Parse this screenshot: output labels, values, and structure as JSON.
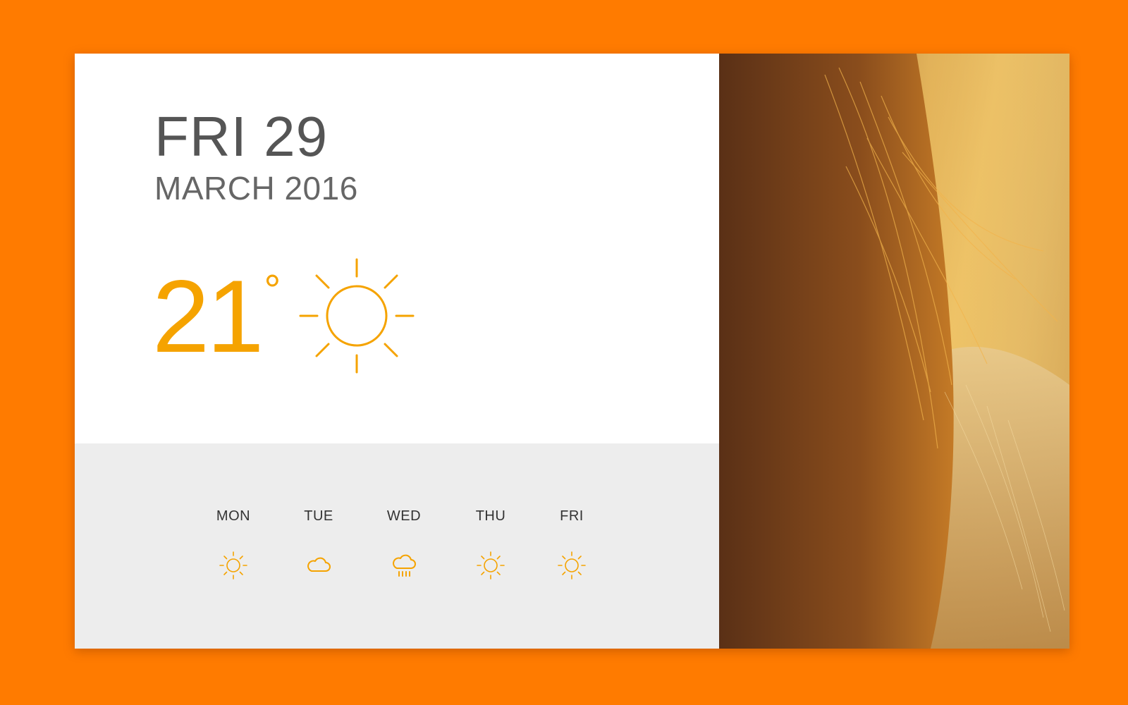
{
  "today": {
    "day_line": "FRI 29",
    "date_line": "MARCH 2016",
    "temperature": "21",
    "degree_symbol": "°",
    "condition_icon": "sun-icon",
    "accent_color": "#F5A300"
  },
  "forecast": [
    {
      "label": "MON",
      "icon": "sun-icon"
    },
    {
      "label": "TUE",
      "icon": "cloud-icon"
    },
    {
      "label": "WED",
      "icon": "rain-cloud-icon"
    },
    {
      "label": "THU",
      "icon": "sun-icon"
    },
    {
      "label": "FRI",
      "icon": "sun-icon"
    }
  ],
  "photo": {
    "subject": "woman-hair-sunset-photo"
  },
  "colors": {
    "background": "#FF7B00",
    "card": "#FFFFFF",
    "forecast_panel": "#EDEDED",
    "text_primary": "#555555"
  }
}
